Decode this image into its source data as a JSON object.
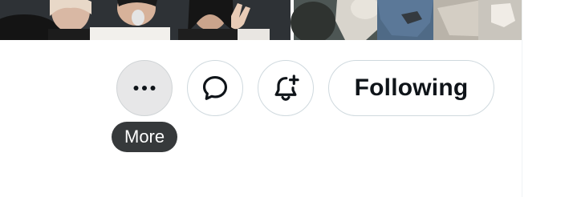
{
  "profile_actions": {
    "more_tooltip": "More",
    "follow_label": "Following",
    "more_icon": "more-horizontal-icon",
    "message_icon": "message-bubble-icon",
    "notify_icon": "bell-plus-icon"
  },
  "colors": {
    "button_border": "#cfd9de",
    "button_hover_bg": "#e7e7e8",
    "text_primary": "#0f1419",
    "tooltip_bg": "#36393b",
    "tooltip_text": "#ffffff"
  }
}
